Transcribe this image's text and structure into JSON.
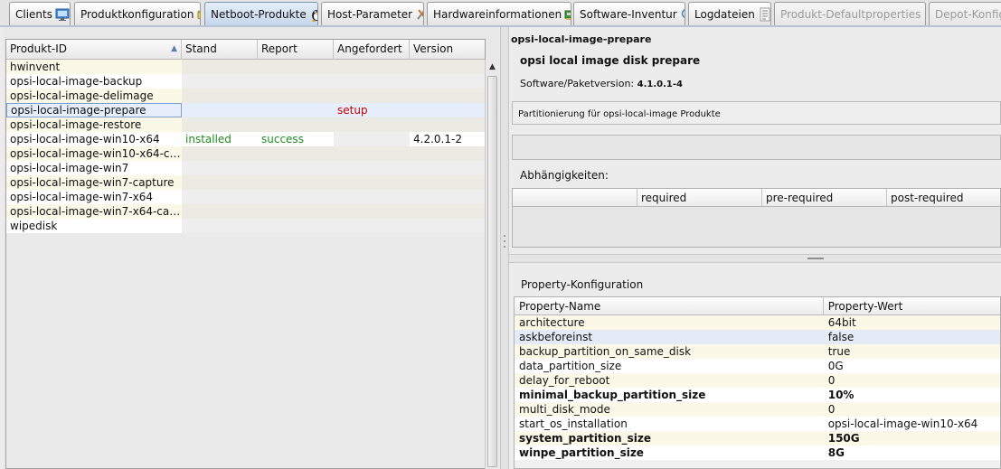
{
  "tabs": [
    {
      "label": "Clients",
      "icon": "monitor-icon",
      "state": "normal"
    },
    {
      "label": "Produktkonfiguration",
      "icon": "package-icon",
      "state": "normal"
    },
    {
      "label": "Netboot-Produkte",
      "icon": "linux-penguin-icon",
      "state": "active"
    },
    {
      "label": "Host-Parameter",
      "icon": "tools-icon",
      "state": "normal"
    },
    {
      "label": "Hardwareinformationen",
      "icon": "hardware-card-icon",
      "state": "normal"
    },
    {
      "label": "Software-Inventur",
      "icon": "magnifier-icon",
      "state": "normal"
    },
    {
      "label": "Logdateien",
      "icon": "document-icon",
      "state": "normal"
    },
    {
      "label": "Produkt-Defaultproperties",
      "icon": "tools-icon",
      "state": "disabled"
    },
    {
      "label": "Depot-Konfig",
      "icon": "",
      "state": "disabled"
    }
  ],
  "products_table": {
    "columns": [
      "Produkt-ID",
      "Stand",
      "Report",
      "Angefordert",
      "Version"
    ],
    "rows": [
      {
        "id": "hwinvent",
        "stand": "",
        "report": "",
        "angefordert": "",
        "version": ""
      },
      {
        "id": "opsi-local-image-backup",
        "stand": "",
        "report": "",
        "angefordert": "",
        "version": ""
      },
      {
        "id": "opsi-local-image-delimage",
        "stand": "",
        "report": "",
        "angefordert": "",
        "version": ""
      },
      {
        "id": "opsi-local-image-prepare",
        "stand": "",
        "report": "",
        "angefordert": "setup",
        "version": ""
      },
      {
        "id": "opsi-local-image-restore",
        "stand": "",
        "report": "",
        "angefordert": "",
        "version": ""
      },
      {
        "id": "opsi-local-image-win10-x64",
        "stand": "installed",
        "report": "success",
        "angefordert": "",
        "version": "4.2.0.1-2"
      },
      {
        "id": "opsi-local-image-win10-x64-ca...",
        "stand": "",
        "report": "",
        "angefordert": "",
        "version": ""
      },
      {
        "id": "opsi-local-image-win7",
        "stand": "",
        "report": "",
        "angefordert": "",
        "version": ""
      },
      {
        "id": "opsi-local-image-win7-capture",
        "stand": "",
        "report": "",
        "angefordert": "",
        "version": ""
      },
      {
        "id": "opsi-local-image-win7-x64",
        "stand": "",
        "report": "",
        "angefordert": "",
        "version": ""
      },
      {
        "id": "opsi-local-image-win7-x64-capt...",
        "stand": "",
        "report": "",
        "angefordert": "",
        "version": ""
      },
      {
        "id": "wipedisk",
        "stand": "",
        "report": "",
        "angefordert": "",
        "version": ""
      }
    ]
  },
  "details": {
    "product_id": "opsi-local-image-prepare",
    "product_name": "opsi local image disk prepare",
    "version_label": "Software/Paketversion:",
    "version_value": "4.1.0.1-4",
    "description": "Partitionierung für opsi-local-image Produkte",
    "dependencies_label": "Abhängigkeiten:",
    "dependency_columns": [
      "",
      "required",
      "pre-required",
      "post-required"
    ],
    "property_label": "Property-Konfiguration",
    "property_columns": [
      "Property-Name",
      "Property-Wert"
    ],
    "properties": [
      {
        "name": "architecture",
        "value": "64bit",
        "bold": false
      },
      {
        "name": "askbeforeinst",
        "value": "false",
        "bold": false
      },
      {
        "name": "backup_partition_on_same_disk",
        "value": "true",
        "bold": false
      },
      {
        "name": "data_partition_size",
        "value": "0G",
        "bold": false
      },
      {
        "name": "delay_for_reboot",
        "value": "0",
        "bold": false
      },
      {
        "name": "minimal_backup_partition_size",
        "value": "10%",
        "bold": true
      },
      {
        "name": "multi_disk_mode",
        "value": "0",
        "bold": false
      },
      {
        "name": "start_os_installation",
        "value": "opsi-local-image-win10-x64",
        "bold": false
      },
      {
        "name": "system_partition_size",
        "value": "150G",
        "bold": true
      },
      {
        "name": "winpe_partition_size",
        "value": "8G",
        "bold": true
      }
    ]
  },
  "colors": {
    "installed": "#1f8a1f",
    "success": "#1f8a1f",
    "setup": "#c00000",
    "active_tab": "#c6d6ea",
    "stripe": "#fbf8e8"
  }
}
